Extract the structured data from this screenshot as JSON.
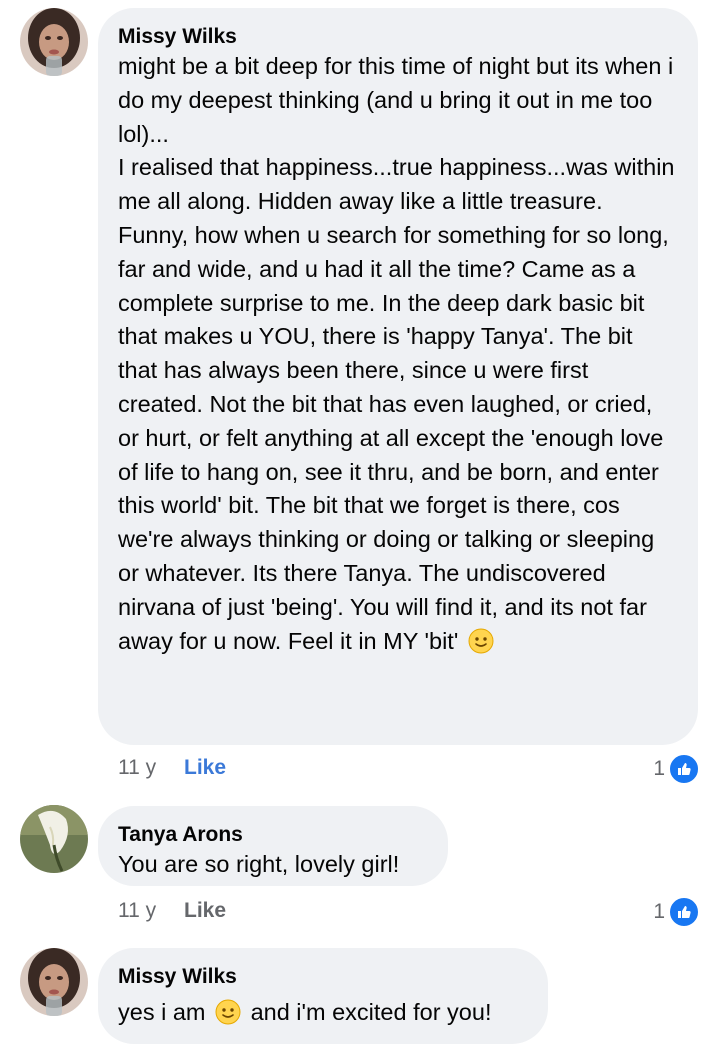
{
  "comments": [
    {
      "author": "Missy Wilks",
      "text": "might be a bit deep for this time of night but its when i do my deepest thinking (and u bring it out in me too lol)...\nI realised that happiness...true happiness...was within me all along. Hidden away like a little treasure. Funny, how when u search for something for so long, far and wide, and u had it all the time? Came as a complete surprise to me. In the deep dark basic bit that makes u YOU, there is 'happy Tanya'. The bit that has always been there, since u were first created. Not the bit that has even laughed, or cried, or hurt, or felt anything at all except the 'enough love of life to hang on, see it thru, and be born, and enter this world' bit. The bit that we forget is there, cos we're always thinking or doing or talking or sleeping or whatever. Its there Tanya. The undiscovered nirvana of just 'being'. You will find it, and its not far away for u now. Feel it in MY 'bit'",
      "emoji": "slightly-smiling-face-icon",
      "time": "11 y",
      "like_label": "Like",
      "like_count": "1"
    },
    {
      "author": "Tanya Arons",
      "text": "You are so right, lovely girl!",
      "time": "11 y",
      "like_label": "Like",
      "like_count": "1"
    },
    {
      "author": "Missy Wilks",
      "text_before": "yes i am",
      "emoji": "slightly-smiling-face-icon",
      "text_after": "and i'm excited for you!"
    }
  ],
  "colors": {
    "bubble": "#eff1f4",
    "meta_text": "#65676b",
    "like_active": "#3b79d8",
    "reaction_badge": "#1877f2"
  }
}
